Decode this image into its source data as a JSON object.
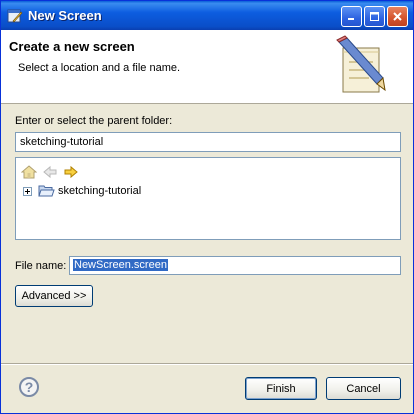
{
  "window": {
    "title": "New Screen",
    "icons": {
      "app": "pencil-window-icon",
      "minimize": "minimize-icon",
      "maximize": "maximize-icon",
      "close": "close-icon"
    }
  },
  "header": {
    "title": "Create a new screen",
    "subtitle": "Select a location and a file name.",
    "icon": "pencil-paper-icon"
  },
  "parent_folder": {
    "label": "Enter or select the parent folder:",
    "value": "sketching-tutorial"
  },
  "tree": {
    "toolbar_icons": [
      "home-icon",
      "back-arrow-icon",
      "forward-arrow-icon"
    ],
    "items": [
      {
        "label": "sketching-tutorial",
        "icon": "open-folder-icon",
        "expander": "plus"
      }
    ]
  },
  "file_name": {
    "label": "File name:",
    "value": "NewScreen.screen"
  },
  "buttons": {
    "advanced": "Advanced >>",
    "finish": "Finish",
    "cancel": "Cancel",
    "help": "?"
  }
}
